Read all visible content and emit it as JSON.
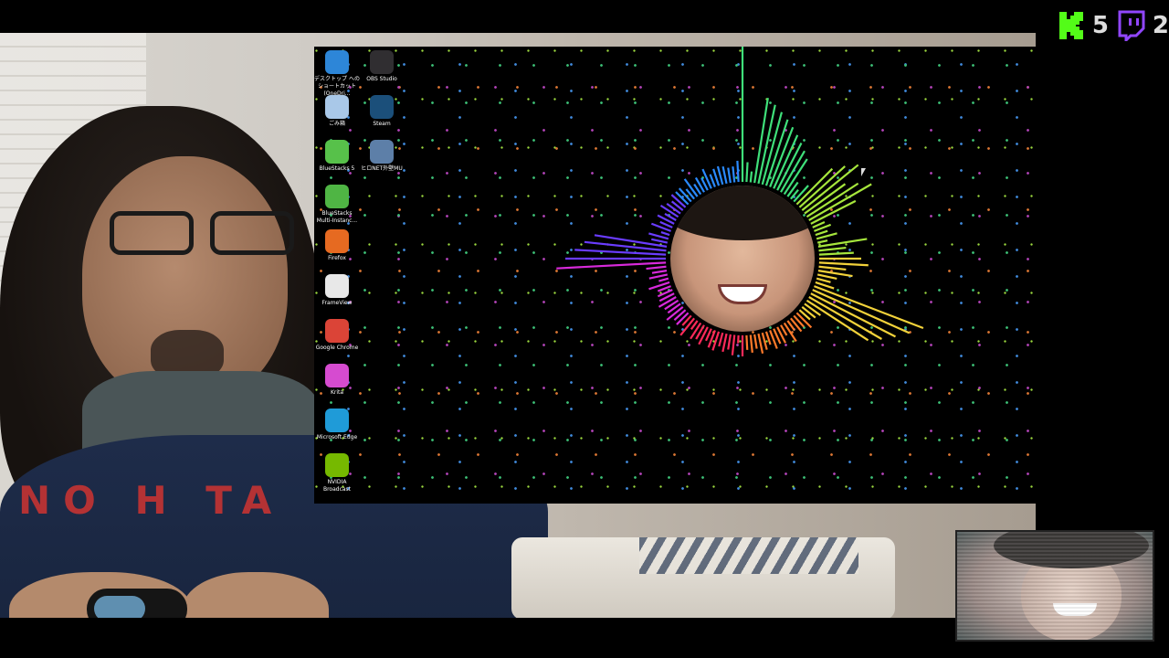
{
  "desktop_icons": [
    {
      "label": "デスクトップ へのショートカット (OneDri...",
      "icon": "onedrive-icon",
      "color": "#2d86d8"
    },
    {
      "label": "OBS Studio",
      "icon": "obs-icon",
      "color": "#302e31"
    },
    {
      "label": "ごみ箱",
      "icon": "recycle-bin-icon",
      "color": "#a9c8e8"
    },
    {
      "label": "Steam",
      "icon": "steam-icon",
      "color": "#1b4f7a"
    },
    {
      "label": "BlueStacks 5",
      "icon": "bluestacks-icon",
      "color": "#57c14a"
    },
    {
      "label": "ヒロNET外壁MU",
      "icon": "app-icon",
      "color": "#5d7fa8"
    },
    {
      "label": "BlueStacks Multi-Instanc...",
      "icon": "bluestacks-multi-icon",
      "color": "#4fb544"
    },
    {
      "label": "Firefox",
      "icon": "firefox-icon",
      "color": "#e66a21"
    },
    {
      "label": "FrameView",
      "icon": "frameview-icon",
      "color": "#e8e8e8"
    },
    {
      "label": "Google Chrome",
      "icon": "chrome-icon",
      "color": "#db4437"
    },
    {
      "label": "Krita",
      "icon": "krita-icon",
      "color": "#d64bd0"
    },
    {
      "label": "Microsoft Edge",
      "icon": "edge-icon",
      "color": "#1f9bd8"
    },
    {
      "label": "NVIDIA Broadcast",
      "icon": "nvidia-broadcast-icon",
      "color": "#76b900"
    }
  ],
  "stream_badges": {
    "kick_count": "5",
    "twitch_count": "2",
    "kick_color": "#53fc18",
    "twitch_color": "#9146ff"
  },
  "sweater_text": "NO H TA",
  "visualizer_colors": [
    "#3fe07a",
    "#a6e63c",
    "#f2d23a",
    "#ff7a2a",
    "#ff2a5a",
    "#d82adb",
    "#6a3cff",
    "#2a8aff"
  ]
}
